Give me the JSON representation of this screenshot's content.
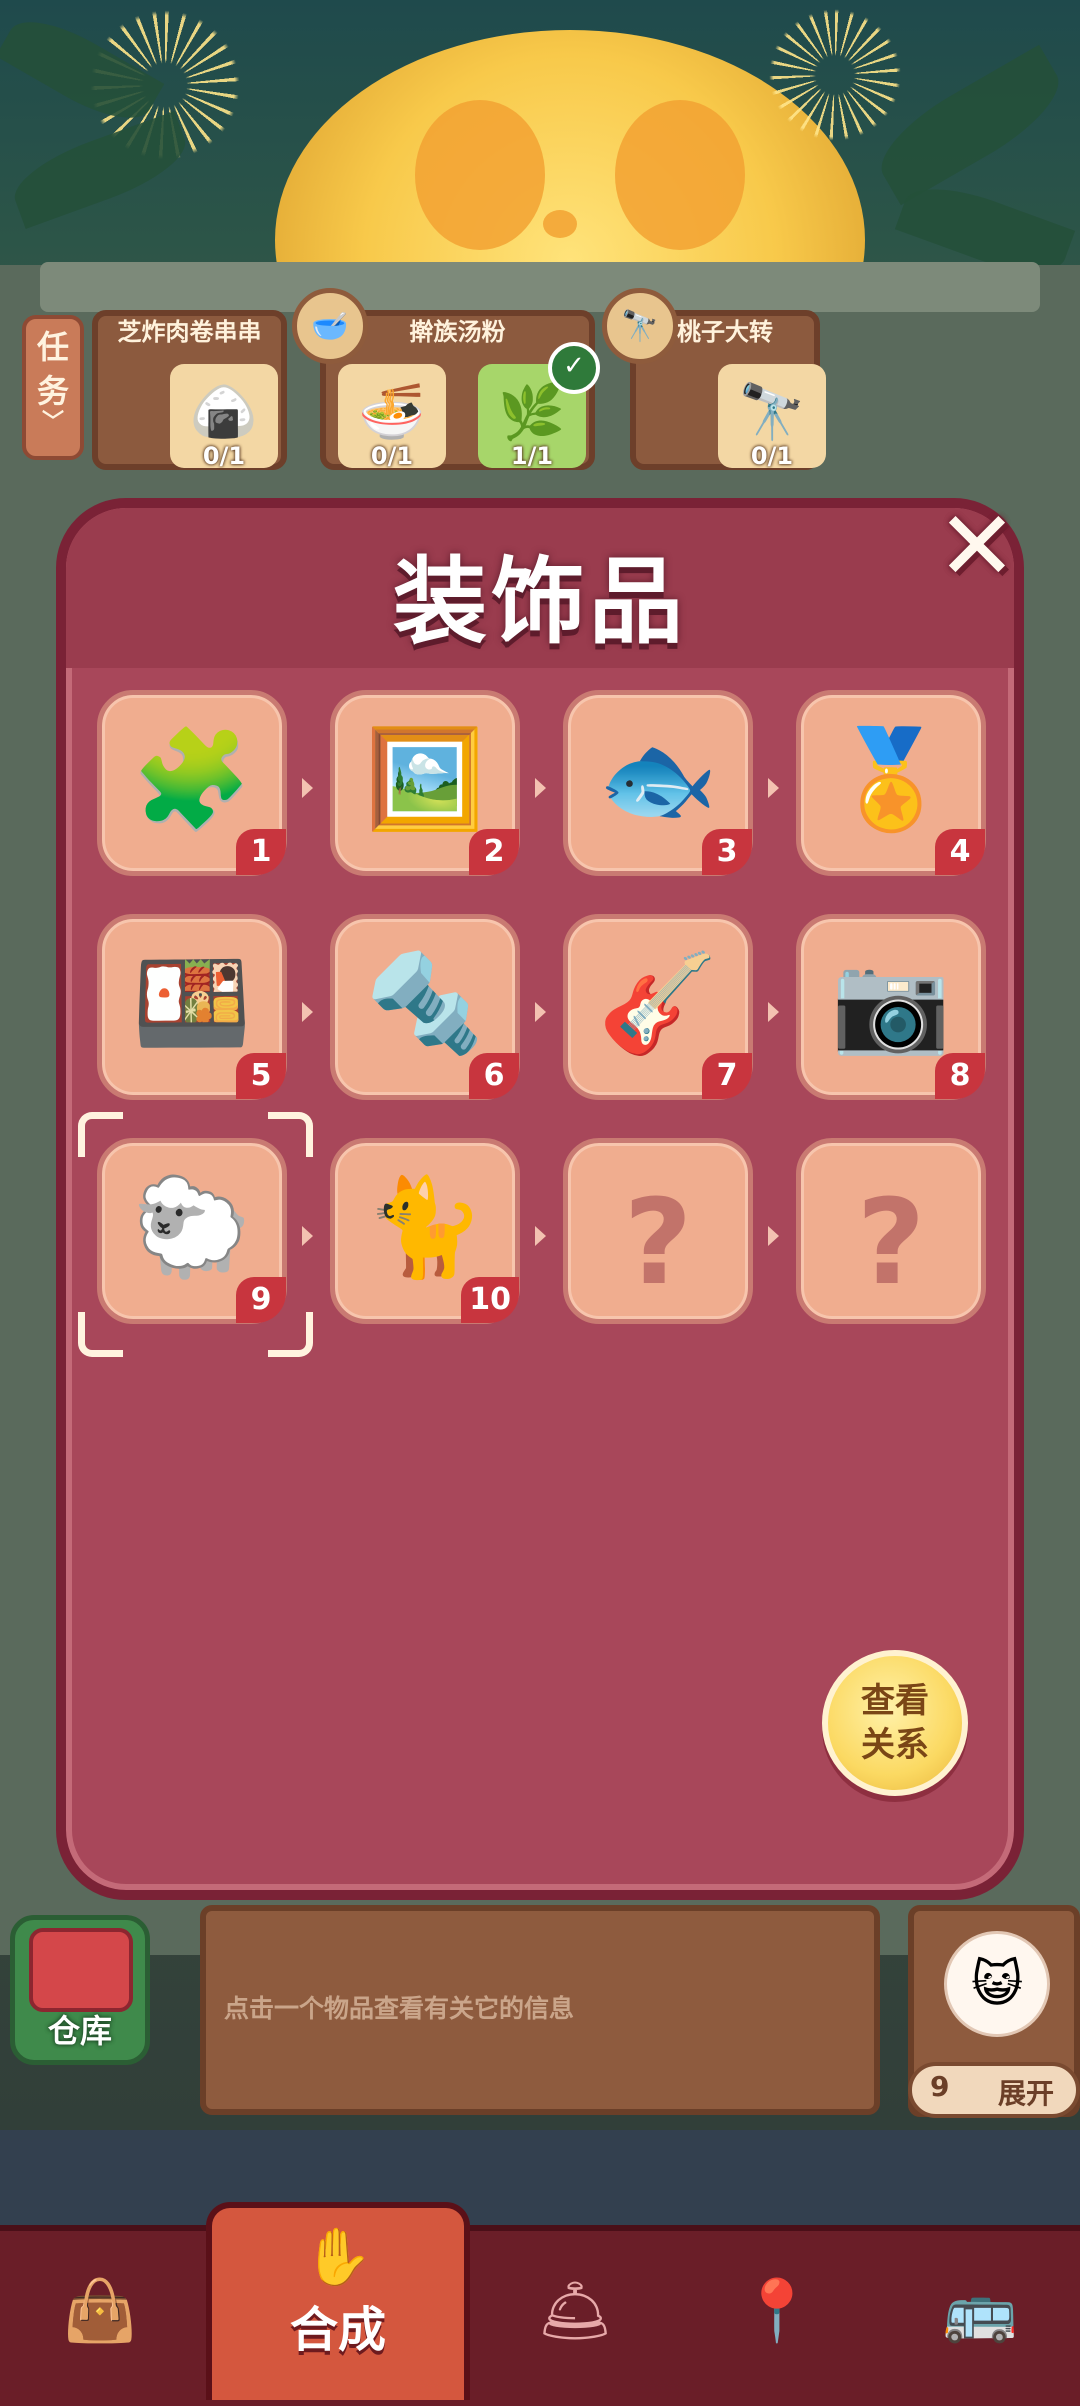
{
  "tasks": {
    "tab_label": "任务",
    "orders": [
      {
        "title": "芝炸肉卷串串",
        "items": [
          {
            "icon": "rice-ball",
            "count": "0/1"
          }
        ]
      },
      {
        "title": "擀族汤粉",
        "badge_icon": "noodle-bowl",
        "items": [
          {
            "icon": "soup-bowl",
            "count": "0/1"
          },
          {
            "icon": "herb-board",
            "count": "1/1",
            "done": true
          }
        ]
      },
      {
        "title": "桃子大转",
        "badge_icon": "telescope",
        "items": [
          {
            "icon": "telescope",
            "count": "0/1"
          }
        ]
      }
    ]
  },
  "modal": {
    "title": "装饰品",
    "close_icon": "close-x",
    "items": [
      {
        "level": "1",
        "icon": "puzzle-pieces",
        "glyph": "🧩"
      },
      {
        "level": "2",
        "icon": "landscape-painting",
        "glyph": "🖼️"
      },
      {
        "level": "3",
        "icon": "fish-statue",
        "glyph": "🐟"
      },
      {
        "level": "4",
        "icon": "chef-medal",
        "glyph": "🏅"
      },
      {
        "level": "5",
        "icon": "bento-box",
        "glyph": "🍱"
      },
      {
        "level": "6",
        "icon": "rolling-pin",
        "glyph": "🔩"
      },
      {
        "level": "7",
        "icon": "guitar",
        "glyph": "🎸"
      },
      {
        "level": "8",
        "icon": "camera",
        "glyph": "📷"
      },
      {
        "level": "9",
        "icon": "sheep-plush",
        "glyph": "🐑",
        "selected": true
      },
      {
        "level": "10",
        "icon": "jade-cat",
        "glyph": "🐈"
      },
      {
        "level": "",
        "icon": "unknown",
        "glyph": "?",
        "locked": true
      },
      {
        "level": "",
        "icon": "unknown",
        "glyph": "?",
        "locked": true
      }
    ],
    "relation_button": {
      "line1": "查看",
      "line2": "关系"
    }
  },
  "info": {
    "warehouse_label": "仓库",
    "hint": "点击一个物品查看有关它的信息",
    "cat_count": "9",
    "expand_label": "展开"
  },
  "nav": {
    "items": [
      {
        "icon": "shopping-bag"
      },
      {
        "icon": "merge",
        "label": "合成",
        "active": true
      },
      {
        "icon": "cloche"
      },
      {
        "icon": "map-pin"
      },
      {
        "icon": "bus"
      }
    ]
  },
  "colors": {
    "modal_bg": "#a8475a",
    "cell_bg": "#f0ad8f",
    "badge_red": "#c8353e",
    "nav_active": "#d4573e"
  }
}
